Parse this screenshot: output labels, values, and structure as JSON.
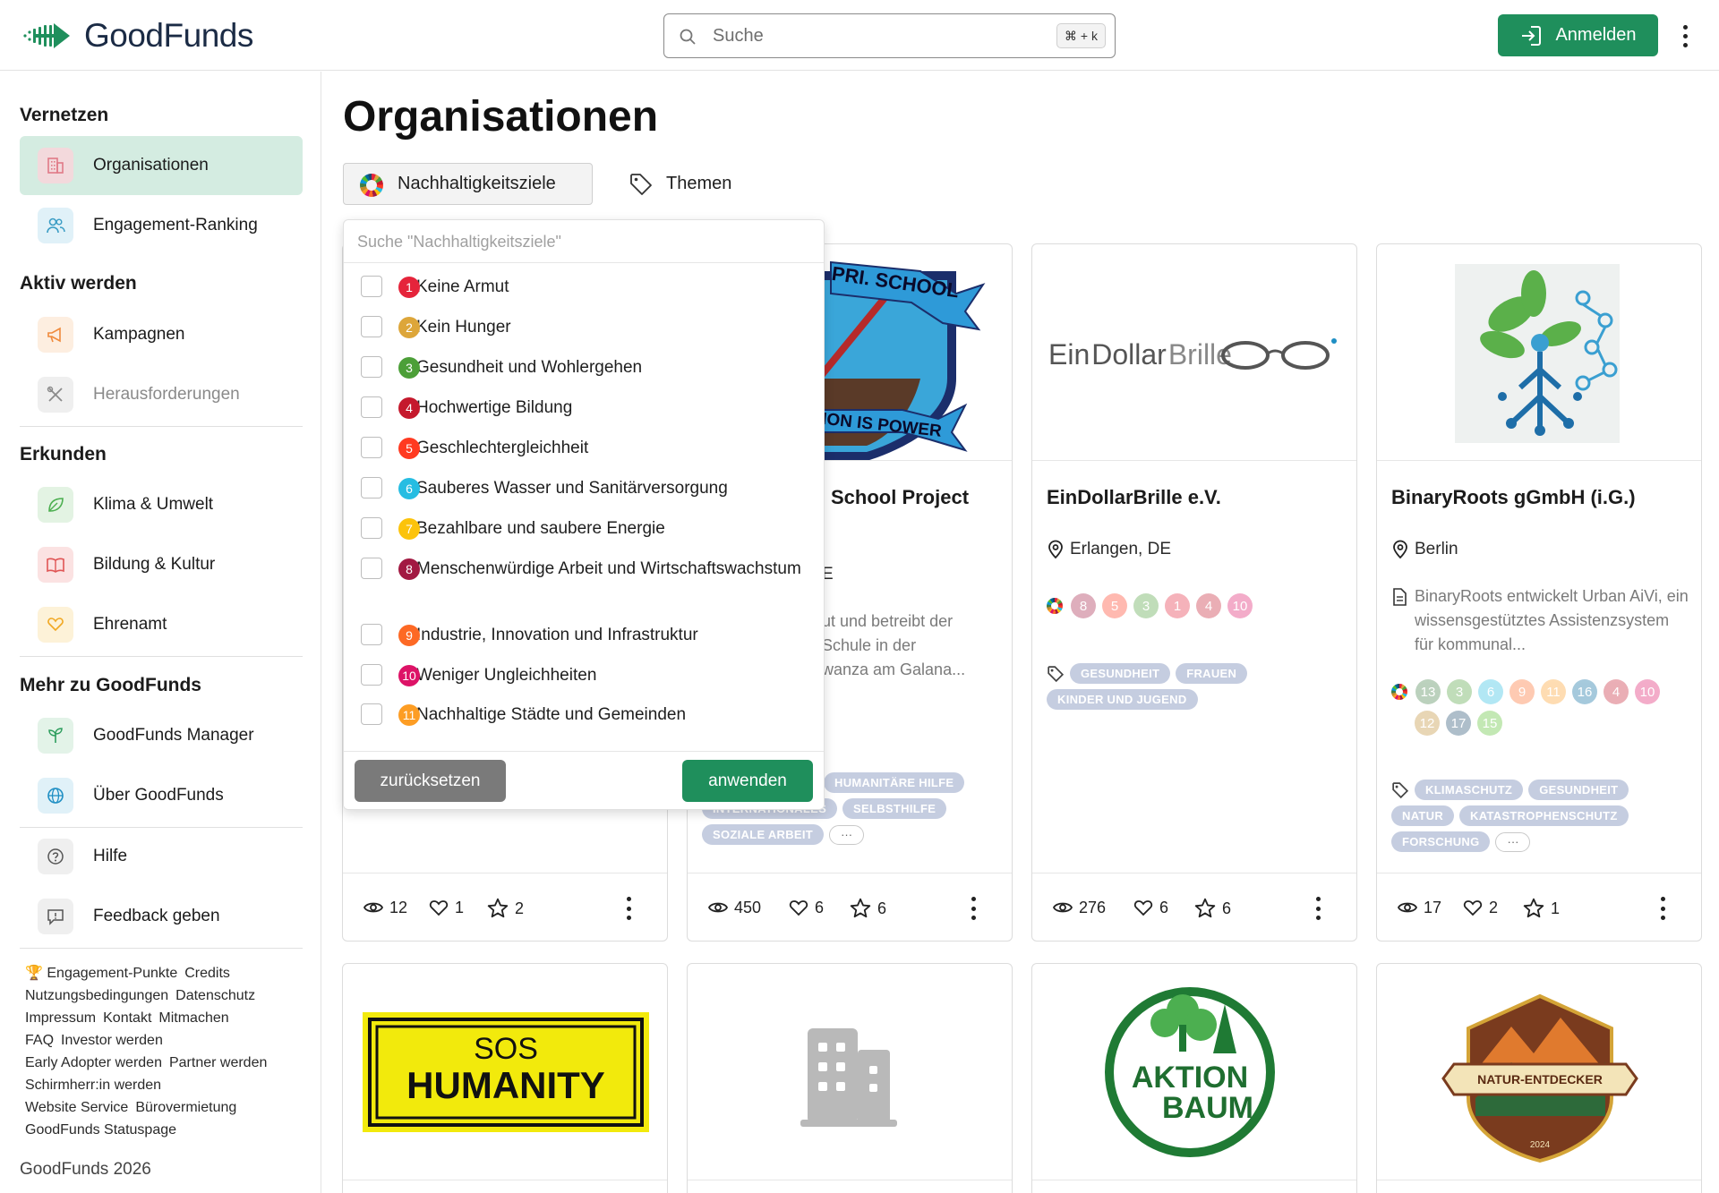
{
  "header": {
    "logo_text": "GoodFunds",
    "search_placeholder": "Suche",
    "search_shortcut": "⌘ + k",
    "login_label": "Anmelden"
  },
  "sidebar": {
    "sections": [
      {
        "title": "Vernetzen",
        "items": [
          {
            "label": "Organisationen",
            "icon": "building-icon",
            "active": true
          },
          {
            "label": "Engagement-Ranking",
            "icon": "users-icon"
          }
        ]
      },
      {
        "title": "Aktiv werden",
        "items": [
          {
            "label": "Kampagnen",
            "icon": "megaphone-icon"
          },
          {
            "label": "Herausforderungen",
            "icon": "tools-icon",
            "disabled": true
          }
        ]
      },
      {
        "title": "Erkunden",
        "items": [
          {
            "label": "Klima & Umwelt",
            "icon": "leaf-icon"
          },
          {
            "label": "Bildung & Kultur",
            "icon": "book-icon"
          },
          {
            "label": "Ehrenamt",
            "icon": "heart-hand-icon"
          }
        ]
      },
      {
        "title": "Mehr zu GoodFunds",
        "items": [
          {
            "label": "GoodFunds Manager",
            "icon": "sprout-icon"
          },
          {
            "label": "Über GoodFunds",
            "icon": "globe-icon"
          }
        ]
      }
    ],
    "extra_items": [
      {
        "label": "Hilfe",
        "icon": "help-icon"
      },
      {
        "label": "Feedback geben",
        "icon": "feedback-icon"
      }
    ],
    "footer_links": [
      "🏆 Engagement-Punkte",
      "Credits",
      "Nutzungsbedingungen",
      "Datenschutz",
      "Impressum",
      "Kontakt",
      "Mitmachen",
      "FAQ",
      "Investor werden",
      "Early Adopter werden",
      "Partner werden",
      "Schirmherr:in werden",
      "Website Service",
      "Bürovermietung",
      "GoodFunds Statuspage"
    ],
    "copyright": "GoodFunds 2026"
  },
  "main": {
    "title": "Organisationen",
    "filter_sdg_label": "Nachhaltigkeitsziele",
    "filter_themes_label": "Themen"
  },
  "dropdown": {
    "search_placeholder": "Suche \"Nachhaltigkeitsziele\"",
    "items": [
      {
        "num": "1",
        "label": "Keine Armut",
        "color": "#e5243b"
      },
      {
        "num": "2",
        "label": "Kein Hunger",
        "color": "#dda63a"
      },
      {
        "num": "3",
        "label": "Gesundheit und Wohlergehen",
        "color": "#4c9f38"
      },
      {
        "num": "4",
        "label": "Hochwertige Bildung",
        "color": "#c5192d"
      },
      {
        "num": "5",
        "label": "Geschlechtergleichheit",
        "color": "#ff3a21"
      },
      {
        "num": "6",
        "label": "Sauberes Wasser und Sanitärversorgung",
        "color": "#26bde2"
      },
      {
        "num": "7",
        "label": "Bezahlbare und saubere Energie",
        "color": "#fcc30b"
      },
      {
        "num": "8",
        "label": "Menschenwürdige Arbeit und Wirtschaftswachstum",
        "color": "#a21942"
      },
      {
        "num": "9",
        "label": "Industrie, Innovation und Infrastruktur",
        "color": "#fd6925"
      },
      {
        "num": "10",
        "label": "Weniger Ungleichheiten",
        "color": "#dd1367"
      },
      {
        "num": "11",
        "label": "Nachhaltige Städte und Gemeinden",
        "color": "#fd9d24"
      }
    ],
    "reset_label": "zurücksetzen",
    "apply_label": "anwenden"
  },
  "cards": [
    {
      "name": "",
      "stats": {
        "views": "12",
        "likes": "1",
        "stars": "2"
      }
    },
    {
      "name": "School Project",
      "partial_loc": "E",
      "desc": "ut und betreibt der\nSchule in der\nwanza am Galana...",
      "logo_text_top": "PRI. SCHOOL",
      "logo_text_bottom": "ION IS POWER",
      "tags": [
        "HUMANITÄRE HILFE",
        "INTERNATIONALES",
        "SELBSTHILFE",
        "SOZIALE ARBEIT"
      ],
      "stats": {
        "views": "450",
        "likes": "6",
        "stars": "6"
      }
    },
    {
      "name": "EinDollarBrille e.V.",
      "location": "Erlangen, DE",
      "logo_text_a": "Ein",
      "logo_text_b": "Dollar",
      "logo_text_c": "Brille",
      "sdgs": [
        "8",
        "5",
        "3",
        "1",
        "4",
        "10"
      ],
      "tags": [
        "GESUNDHEIT",
        "FRAUEN",
        "KINDER UND JUGEND"
      ],
      "stats": {
        "views": "276",
        "likes": "6",
        "stars": "6"
      }
    },
    {
      "name": "BinaryRoots gGmbH (i.G.)",
      "location": "Berlin",
      "desc": "BinaryRoots entwickelt Urban AiVi, ein wissensgestütztes Assistenzsystem für kommunal...",
      "sdgs": [
        "13",
        "3",
        "6",
        "9",
        "11",
        "16",
        "4",
        "10",
        "12",
        "17",
        "15"
      ],
      "tags": [
        "KLIMASCHUTZ",
        "GESUNDHEIT",
        "NATUR",
        "KATASTROPHENSCHUTZ",
        "FORSCHUNG"
      ],
      "stats": {
        "views": "17",
        "likes": "2",
        "stars": "1"
      }
    },
    {
      "logo_text_top": "SOS",
      "logo_text_bottom": "HUMANITY"
    },
    {},
    {
      "logo_text_top": "AKTION",
      "logo_text_bottom": "BAUM"
    },
    {
      "logo_text": "NATUR-ENTDECKER",
      "logo_year": "2024"
    }
  ],
  "colors": {
    "brand_green": "#1f8f5c",
    "active_nav": "#d4ece1",
    "tag_bg": "#c5cde0"
  }
}
